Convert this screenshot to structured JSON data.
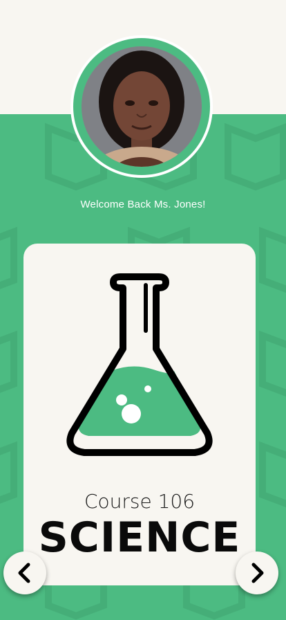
{
  "profile": {
    "avatar": "teacher-portrait-photo",
    "welcome_text": "Welcome Back Ms. Jones!"
  },
  "course_card": {
    "icon": "flask-icon",
    "course_number": "Course 106",
    "subject": "SCIENCE"
  },
  "navigation": {
    "prev_icon": "chevron-left-icon",
    "next_icon": "chevron-right-icon"
  },
  "colors": {
    "accent_green": "#4cbb82",
    "card_background": "#f8f6f1",
    "text_dark": "#0a0a0a"
  }
}
